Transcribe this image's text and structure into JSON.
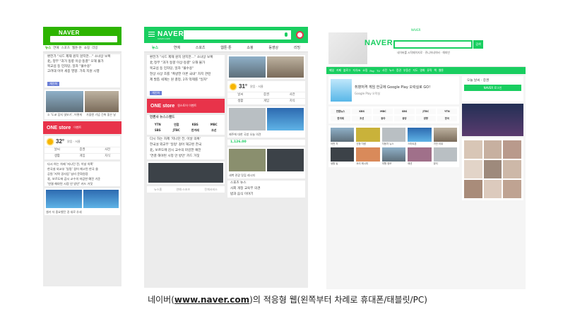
{
  "caption": {
    "prefix": "네이버(",
    "url": "www.naver.com",
    "suffix": ")의 적응형 웹(왼쪽부터 차례로 휴대폰/태블릿/PC)"
  },
  "brand": "NAVER",
  "colors": {
    "naver_green": "#2db400",
    "tablet_green": "#19ce60",
    "onestore_red": "#e8334a"
  },
  "phone": {
    "tabs": [
      "뉴스",
      "연예",
      "스포츠",
      "웹툰·툰",
      "쇼핑",
      "리빙"
    ],
    "news": [
      "환전가 \"사드 제재 원치 않지만…\" 소녀상 보복",
      "北, 정부 \"과거 동향 이상·동결\" 오해 불가",
      "북교섭 등 민자당, 일자 \"불수용\"",
      "고려대 이어 세종 영향. 가족 지원 시행"
    ],
    "tag": "개인화",
    "photo_captions": [
      "소 '도쿄 잡지 엿보기', 어떻게",
      "가을엔 기념 건축 좋은 날"
    ],
    "banner": {
      "title": "ONE store",
      "sub": "이벤트"
    },
    "weather": {
      "temp": "32°",
      "desc": "맑음 · 서울"
    },
    "grid": [
      "날씨",
      "증권",
      "사전",
      "생활",
      "게임",
      "지식"
    ],
    "more_news": [
      "다시 하는 차제 '지나던 전, 이날 의혹'",
      "한국설 외교부 '일렁' 걸어 해고된 한국 쓸",
      "공원 '지역 경사업' 날리 문화원장",
      "北, 보르도에 감시 교수의 마감한 예전 기준",
      "'연결 해야된 시정 안 방안' 카드 거짓"
    ],
    "bottom_caption": "셀카 자 중요했던 경 새로 추세"
  },
  "tablet": {
    "sub": "naver.com",
    "tabs": [
      "뉴스",
      "연예",
      "스포츠",
      "웹툰·툰",
      "쇼핑",
      "동영상",
      "리빙"
    ],
    "news": [
      "환전가 \"사드 제재 원치 않지만…\" 소녀상 보복",
      "北 정부 \"과거 동향 이상·동결\" 오해 불가",
      "북교섭 등 민자당, 일자 \"불수용\"",
      "현상 사상 조를 \"폭방한 이론 국내\" 차지 관련",
      "제 발톱 세계는 원 결정, 2차 억제를 \"일자\""
    ],
    "tag": "개인화",
    "weather": {
      "temp": "31°",
      "desc": "맑음 · 서울"
    },
    "banner": {
      "title": "ONE store",
      "sub": "원스토어 이벤트"
    },
    "press_head": "언론사 뉴스스탠드",
    "press": [
      "YTN",
      "연합",
      "KBS",
      "MBC",
      "SBS",
      "JTBC",
      "한겨레",
      "조선"
    ],
    "list2": [
      "다시 하는 차제 '지나던 전, 이날 의혹'",
      "한국설 외교부 '일렁' 걸어 해고된 한국",
      "北, 보르도에 감시 교수의 마감한 예전",
      "'연결 해야된 시정 안 방안' 카드 거짓"
    ],
    "footer": [
      "뉴스홈",
      "연예·스포츠",
      "전체서비스"
    ],
    "right_caption1": "제주에 대한 국방 오늘 의견",
    "price": "1,126.00",
    "right_caption2": "새벽 관광 맛집 레시피",
    "right_list": [
      "스포츠 뉴스",
      "사회 개정 교육부 의견",
      "밥과 음식 이야기"
    ]
  },
  "pc": {
    "top_tiny": "NAVER",
    "search_btn": "검색",
    "top_links": "네이버를 시작페이지로 · 쥬니어네이버 · 해피빈",
    "nav": [
      "메일",
      "카페",
      "블로그",
      "지식iN",
      "쇼핑",
      "Pay",
      "TV",
      "사전",
      "뉴스",
      "증권",
      "부동산",
      "지도",
      "영화",
      "뮤직",
      "책",
      "웹툰"
    ],
    "ad": {
      "title": "취향저격 게임 한곳에 Google Play 오락실로 GO!",
      "sub": "Google Play 오락실"
    },
    "news_logos": [
      "연합뉴스",
      "KBS",
      "MBC",
      "SBS",
      "JTBC",
      "YTN",
      "한겨레",
      "조선",
      "동아",
      "중앙",
      "경향",
      "한국"
    ],
    "thumbs": [
      "어떤 차",
      "신형 차량",
      "자동차 뉴스",
      "스마트폰",
      "가전 리뷰",
      "생활 팁",
      "요리 레시피",
      "여행 정보",
      "패션",
      "뷰티"
    ],
    "login_btn": "NAVER 로그인",
    "side_text": "오늘 날씨 · 증권"
  }
}
